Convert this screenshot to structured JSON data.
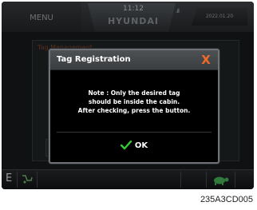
{
  "status_bar": {
    "menu_label": "MENU",
    "time": "11:12",
    "brand": "HYUNDAI",
    "signal": ".ıll",
    "date": "2022.01.20"
  },
  "background_screen": {
    "title": "Tag Management"
  },
  "bottom_bar": {
    "mode": "E"
  },
  "dialog": {
    "title": "Tag Registration",
    "close_glyph": "X",
    "message_lines": [
      "Note : Only the desired tag",
      "should be inside the cabin.",
      "After checking, press the button."
    ],
    "ok_label": "OK"
  },
  "colors": {
    "accent_close": "#f06a2a",
    "ok_check": "#33cc33",
    "header": "#4e5154"
  },
  "caption": "235A3CD005"
}
